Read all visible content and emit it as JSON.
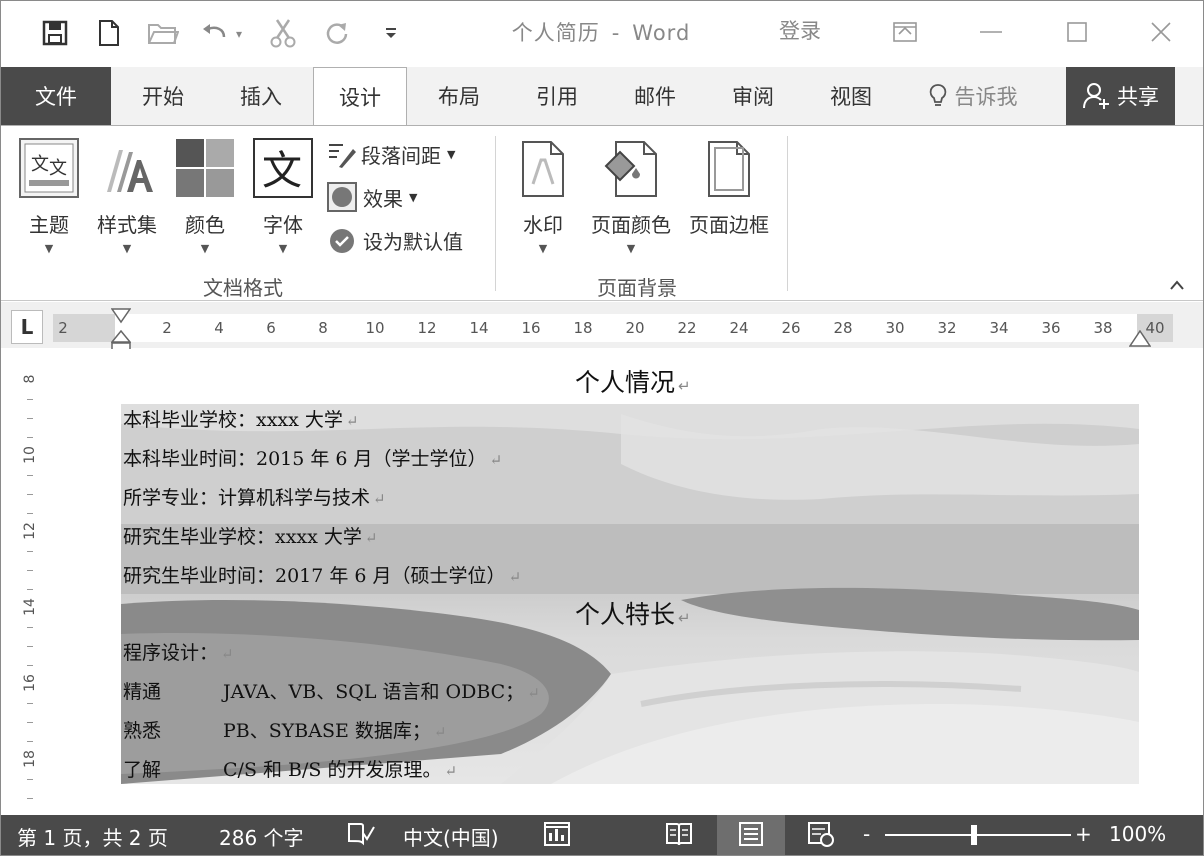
{
  "title": {
    "doc_name": "个人简历",
    "separator": "-",
    "app_name": "Word",
    "login": "登录"
  },
  "tabs": {
    "file": "文件",
    "items": [
      "开始",
      "插入",
      "设计",
      "布局",
      "引用",
      "邮件",
      "审阅",
      "视图"
    ],
    "active": "设计",
    "tell_me": "告诉我",
    "share": "共享"
  },
  "ribbon": {
    "theme": "主题",
    "style_set": "样式集",
    "colors": "颜色",
    "fonts": "字体",
    "paragraph_spacing": "段落间距",
    "effects": "效果",
    "set_default": "设为默认值",
    "group_doc_format": "文档格式",
    "watermark": "水印",
    "page_color": "页面颜色",
    "page_borders": "页面边框",
    "group_page_background": "页面背景",
    "font_icon_char": "文"
  },
  "ruler": {
    "tab_selector": "L",
    "ticks": [
      "2",
      "2",
      "4",
      "6",
      "8",
      "10",
      "12",
      "14",
      "16",
      "18",
      "20",
      "22",
      "24",
      "26",
      "28",
      "30",
      "32",
      "34",
      "36",
      "38",
      "40"
    ],
    "vticks": [
      "8",
      "10",
      "12",
      "14",
      "16",
      "18"
    ]
  },
  "document": {
    "heading1": "个人情况",
    "lines1": [
      "本科毕业学校：xxxx 大学",
      "本科毕业时间：2015 年 6 月（学士学位）",
      "所学专业：计算机科学与技术",
      "研究生毕业学校：xxxx 大学",
      "研究生毕业时间：2017 年 6 月（硕士学位）"
    ],
    "heading2": "个人特长",
    "programming": "程序设计：",
    "skills": [
      {
        "level": "精通",
        "detail": "JAVA、VB、SQL 语言和 ODBC；"
      },
      {
        "level": "熟悉",
        "detail": "PB、SYBASE 数据库；"
      },
      {
        "level": "了解",
        "detail": "C/S 和 B/S  的开发原理。"
      }
    ],
    "para_mark": "↵"
  },
  "status": {
    "page": "第 1 页，共 2 页",
    "words": "286 个字",
    "language": "中文(中国)",
    "zoom": "100%",
    "zoom_minus": "-",
    "zoom_plus": "+"
  },
  "colors": {
    "dark_bar": "#4a4a4a",
    "tab_strip": "#f2f2f2"
  }
}
